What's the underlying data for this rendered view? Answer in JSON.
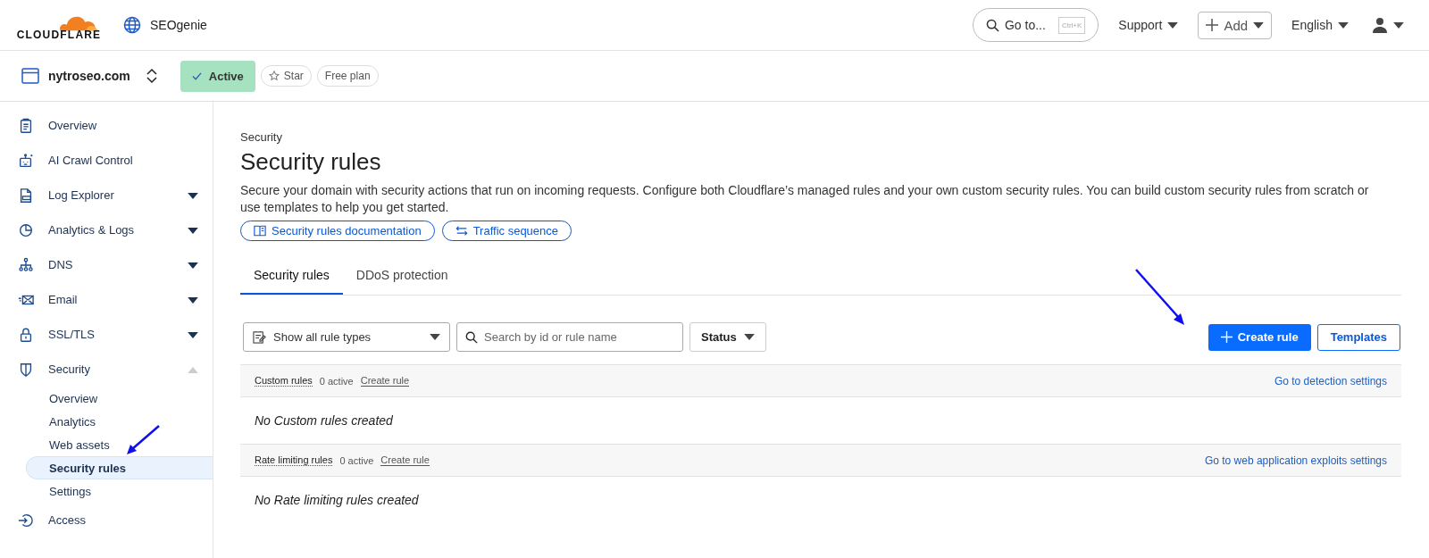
{
  "header": {
    "logo": "CLOUDFLARE",
    "account": "SEOgenie",
    "search": {
      "label": "Go to...",
      "shortcut": "Ctrl+K"
    },
    "menus": [
      {
        "kind": "text",
        "label": "Support"
      },
      {
        "kind": "add",
        "label": "Add"
      },
      {
        "kind": "text",
        "label": "English"
      },
      {
        "kind": "user"
      }
    ]
  },
  "zone": {
    "domain": "nytroseo.com",
    "badges": [
      {
        "kind": "status",
        "label": "Active"
      },
      {
        "kind": "star",
        "label": "Star"
      },
      {
        "kind": "plain",
        "label": "Free plan"
      }
    ]
  },
  "sidebar": {
    "items": [
      {
        "label": "Overview"
      },
      {
        "label": "AI Crawl Control"
      },
      {
        "label": "Log Explorer",
        "expanded": false
      },
      {
        "label": "Analytics & Logs",
        "expanded": false
      },
      {
        "label": "DNS",
        "expanded": false
      },
      {
        "label": "Email",
        "expanded": false
      },
      {
        "label": "SSL/TLS",
        "expanded": false
      },
      {
        "label": "Security",
        "expanded": true,
        "children": [
          {
            "label": "Overview",
            "selected": false
          },
          {
            "label": "Analytics",
            "selected": false
          },
          {
            "label": "Web assets",
            "selected": false
          },
          {
            "label": "Security rules",
            "selected": true
          },
          {
            "label": "Settings",
            "selected": false
          }
        ]
      },
      {
        "label": "Access"
      }
    ]
  },
  "page": {
    "breadcrumb": "Security",
    "title": "Security rules",
    "description": "Secure your domain with security actions that run on incoming requests. Configure both Cloudflare’s managed rules and your own custom security rules. You can build custom security rules from scratch or use templates to help you get started.",
    "links": [
      {
        "label": "Security rules documentation"
      },
      {
        "label": "Traffic sequence"
      }
    ],
    "tabs": [
      {
        "label": "Security rules",
        "selected": true
      },
      {
        "label": "DDoS protection",
        "selected": false
      }
    ],
    "filters": {
      "rule_type": "Show all rule types",
      "search_placeholder": "Search by id or rule name",
      "status": "Status"
    },
    "actions": {
      "create": "Create rule",
      "templates": "Templates"
    },
    "sections": [
      {
        "name": "Custom rules",
        "count": "0 active",
        "create": "Create rule",
        "settings_link": "Go to detection settings",
        "empty": "No Custom rules created"
      },
      {
        "name": "Rate limiting rules",
        "count": "0 active",
        "create": "Create rule",
        "settings_link": "Go to web application exploits settings",
        "empty": "No Rate limiting rules created"
      }
    ]
  }
}
